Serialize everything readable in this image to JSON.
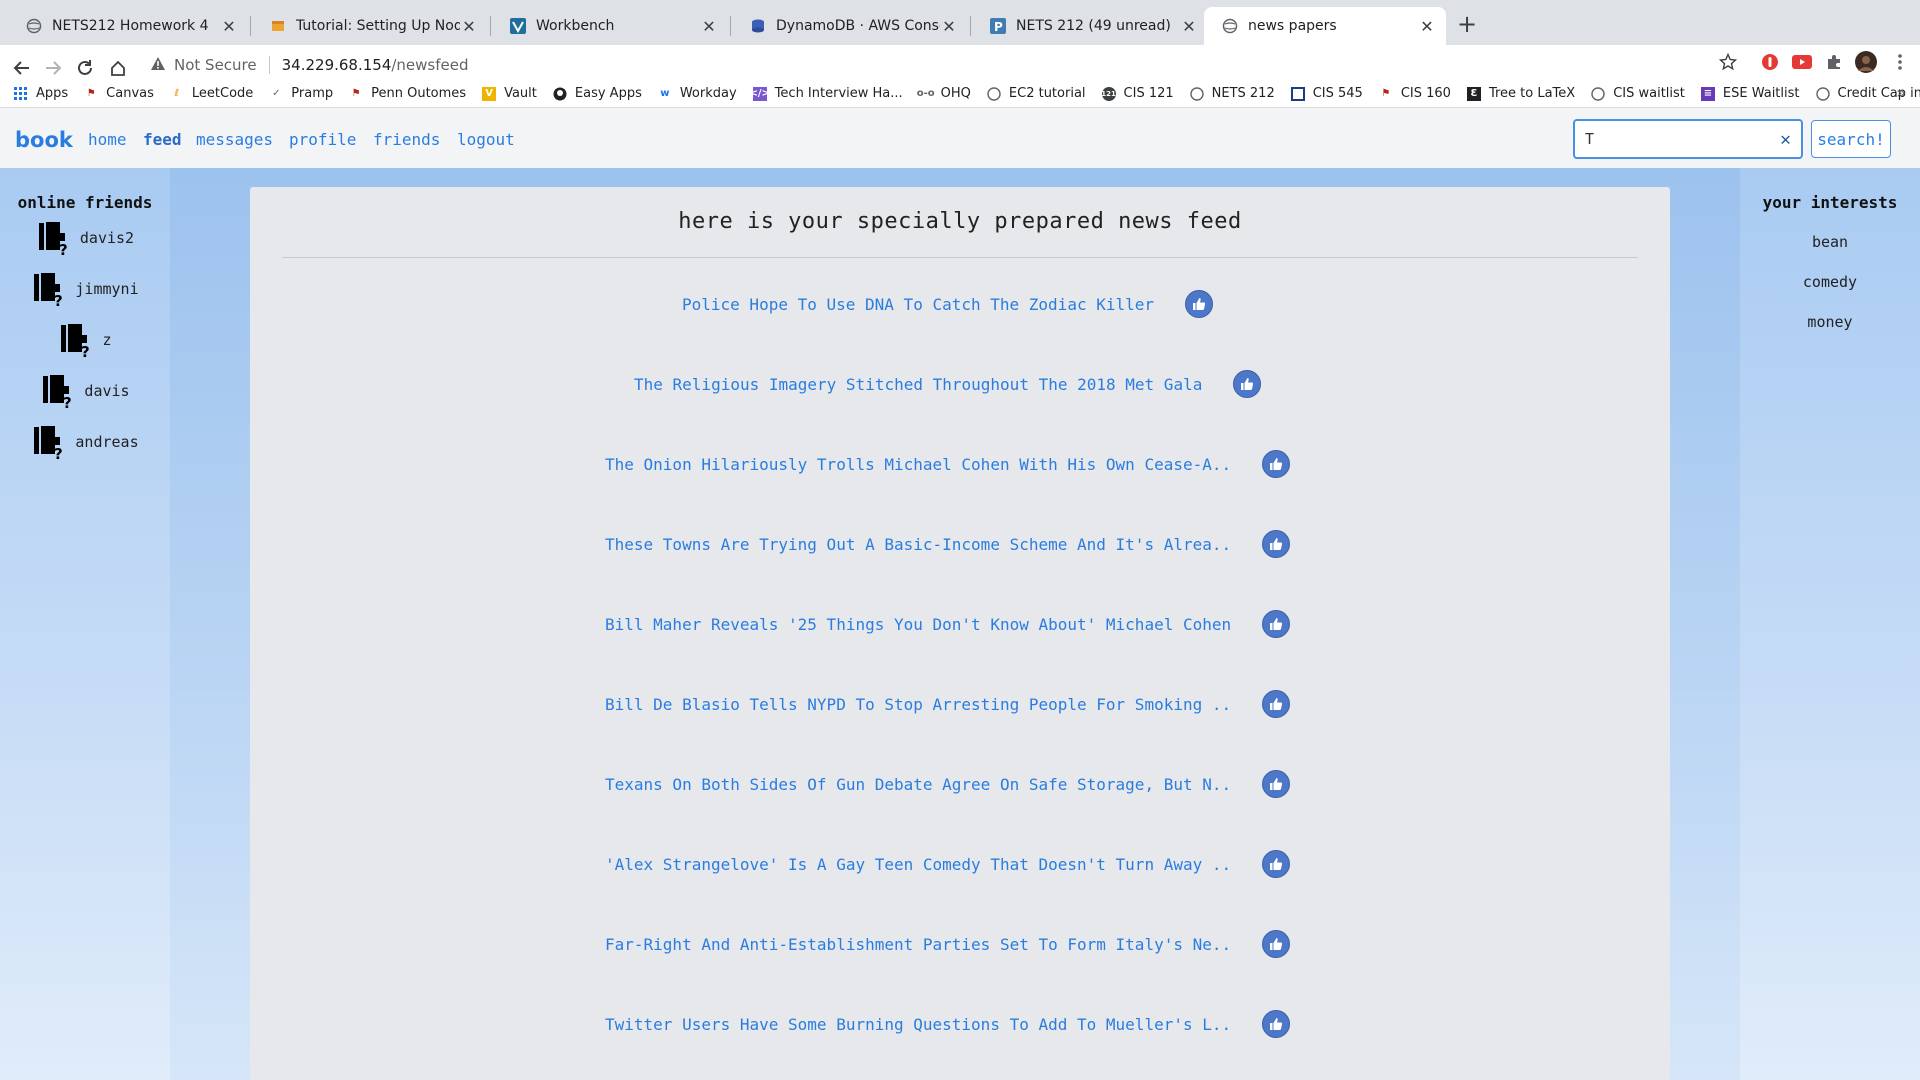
{
  "browser": {
    "tabs": [
      {
        "title": "NETS212 Homework 4",
        "icon": "globe-icon"
      },
      {
        "title": "Tutorial: Setting Up Node.js on",
        "icon": "aws-box-icon"
      },
      {
        "title": "Workbench",
        "icon": "vocareum-v-icon"
      },
      {
        "title": "DynamoDB · AWS Console",
        "icon": "dynamodb-icon"
      },
      {
        "title": "NETS 212 (49 unread)",
        "icon": "piazza-icon"
      },
      {
        "title": "news papers",
        "icon": "globe-icon"
      }
    ],
    "url": {
      "security": "Not Secure",
      "host": "34.229.68.154",
      "path": "/newsfeed"
    },
    "bookmarks": [
      {
        "label": "Apps",
        "icon": "apps-grid-icon"
      },
      {
        "label": "Canvas",
        "icon": "canvas-icon"
      },
      {
        "label": "LeetCode",
        "icon": "leetcode-icon"
      },
      {
        "label": "Pramp",
        "icon": "pramp-icon"
      },
      {
        "label": "Penn Outomes",
        "icon": "penn-icon"
      },
      {
        "label": "Vault",
        "icon": "vault-icon"
      },
      {
        "label": "Easy Apps",
        "icon": "github-icon"
      },
      {
        "label": "Workday",
        "icon": "workday-icon"
      },
      {
        "label": "Tech Interview Ha...",
        "icon": "code-icon"
      },
      {
        "label": "OHQ",
        "icon": "ohq-icon"
      },
      {
        "label": "EC2 tutorial",
        "icon": "globe-icon"
      },
      {
        "label": "CIS 121",
        "icon": "cis121-icon"
      },
      {
        "label": "NETS 212",
        "icon": "globe-icon"
      },
      {
        "label": "CIS 545",
        "icon": "cis545-icon"
      },
      {
        "label": "CIS 160",
        "icon": "penn-icon"
      },
      {
        "label": "Tree to LaTeX",
        "icon": "latex-icon"
      },
      {
        "label": "CIS waitlist",
        "icon": "globe-icon"
      },
      {
        "label": "ESE Waitlist",
        "icon": "form-icon"
      },
      {
        "label": "Credit Cap increase",
        "icon": "globe-icon"
      }
    ]
  },
  "site": {
    "brand": "book",
    "nav": {
      "home": "home",
      "feed": "feed",
      "messages": "messages",
      "profile": "profile",
      "friends": "friends",
      "logout": "logout"
    },
    "search": {
      "value": "T",
      "button": "search!"
    }
  },
  "left": {
    "title": "online friends",
    "friends": [
      "davis2",
      "jimmyni",
      "z",
      "davis",
      "andreas"
    ]
  },
  "right": {
    "title": "your interests",
    "interests": [
      "bean",
      "comedy",
      "money"
    ]
  },
  "feed": {
    "title": "here is your specially prepared news feed",
    "articles": [
      "Police Hope To Use DNA To Catch The Zodiac Killer",
      "The Religious Imagery Stitched Throughout The 2018 Met Gala",
      "The Onion Hilariously Trolls Michael Cohen With His Own Cease-A..",
      "These Towns Are Trying Out A Basic-Income Scheme And It's Alrea..",
      "Bill Maher Reveals '25 Things You Don't Know About' Michael Cohen",
      "Bill De Blasio Tells NYPD To Stop Arresting People For Smoking ..",
      "Texans On Both Sides Of Gun Debate Agree On Safe Storage, But N..",
      "'Alex Strangelove' Is A Gay Teen Comedy That Doesn't Turn Away ..",
      "Far-Right And Anti-Establishment Parties Set To Form Italy's Ne..",
      "Twitter Users Have Some Burning Questions To Add To Mueller's L.."
    ]
  },
  "colors": {
    "link": "#2a7de0",
    "like": "#4d78c9",
    "panel": "#a9cbf2"
  }
}
